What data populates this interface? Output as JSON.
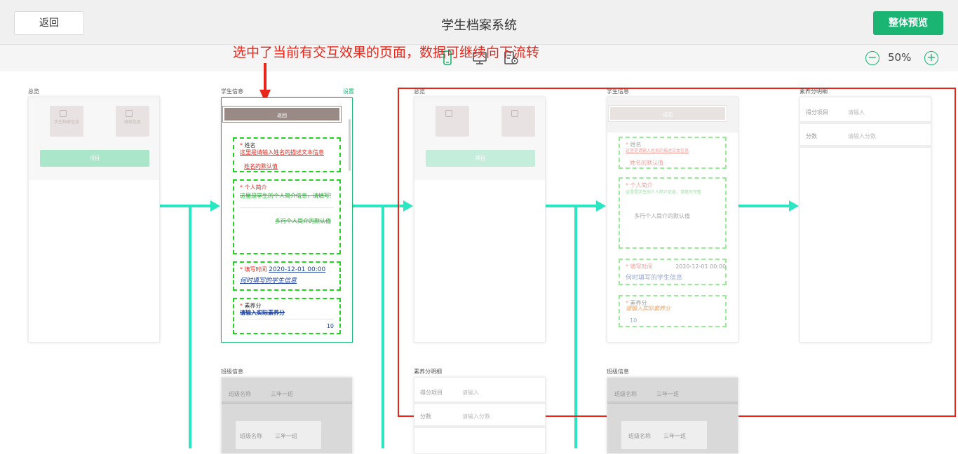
{
  "header": {
    "back_label": "返回",
    "title": "学生档案系统",
    "preview_label": "整体预览"
  },
  "toolbar": {
    "zoom_value": "50%",
    "zoom_out": "−",
    "zoom_in": "+",
    "view_icons": [
      "mobile-icon",
      "desktop-icon",
      "settings-doc-icon"
    ]
  },
  "annotation": "选中了当前有交互效果的页面，数据可继续向下流转",
  "pages": {
    "overview": {
      "label": "总览",
      "tile1": "学生档案信息",
      "tile2": "班级信息",
      "button": "项目"
    },
    "student": {
      "label": "学生信息",
      "settings": "设置",
      "back": "返回",
      "name_title": "姓名",
      "name_desc": "这里是请输入姓名的描述文本信息",
      "name_default": "姓名的默认值",
      "intro_title": "个人简介",
      "intro_desc": "这里是学生的个人简介信息，请填写完整",
      "intro_default": "多行个人简介的默认值",
      "time_title": "填写时间",
      "time_value": "2020-12-01 00:00",
      "time_desc": "何时填写的学生信息",
      "score_title": "素养分",
      "score_desc": "请输入实际素养分",
      "score_value": "10"
    },
    "overview2": {
      "label": "总览",
      "button": "项目"
    },
    "student2": {
      "label": "学生信息",
      "back": "返回",
      "name_title": "姓名",
      "name_desc": "这里是请输入姓名的描述文本信息",
      "name_default": "姓名的默认值",
      "intro_title": "个人简介",
      "intro_desc": "这里是学生的个人简介信息，请填写完整",
      "intro_default": "多行个人简介的默认值",
      "time_title": "填写时间",
      "time_value": "2020-12-01 00:00",
      "time_desc": "何时填写的学生信息",
      "score_title": "素养分",
      "score_desc": "请输入实际素养分",
      "score_value": "10"
    },
    "score_detail": {
      "label": "素养分明细",
      "row1_label": "得分项目",
      "row1_value": "请输入",
      "row2_label": "分数",
      "row2_value": "请输入分数"
    },
    "class_info": {
      "label": "班级信息",
      "row_label": "班级名称",
      "row_value": "三年一班"
    },
    "score_detail2": {
      "label": "素养分明细",
      "row1_label": "得分项目",
      "row1_value": "请输入",
      "row2_label": "分数",
      "row2_value": "请输入分数"
    },
    "class_info2": {
      "label": "班级信息",
      "row_label": "班级名称",
      "row_value": "三年一班"
    }
  },
  "colors": {
    "accent": "#1ab572",
    "flow": "#2ae6c1",
    "annotation": "#e8271c"
  }
}
